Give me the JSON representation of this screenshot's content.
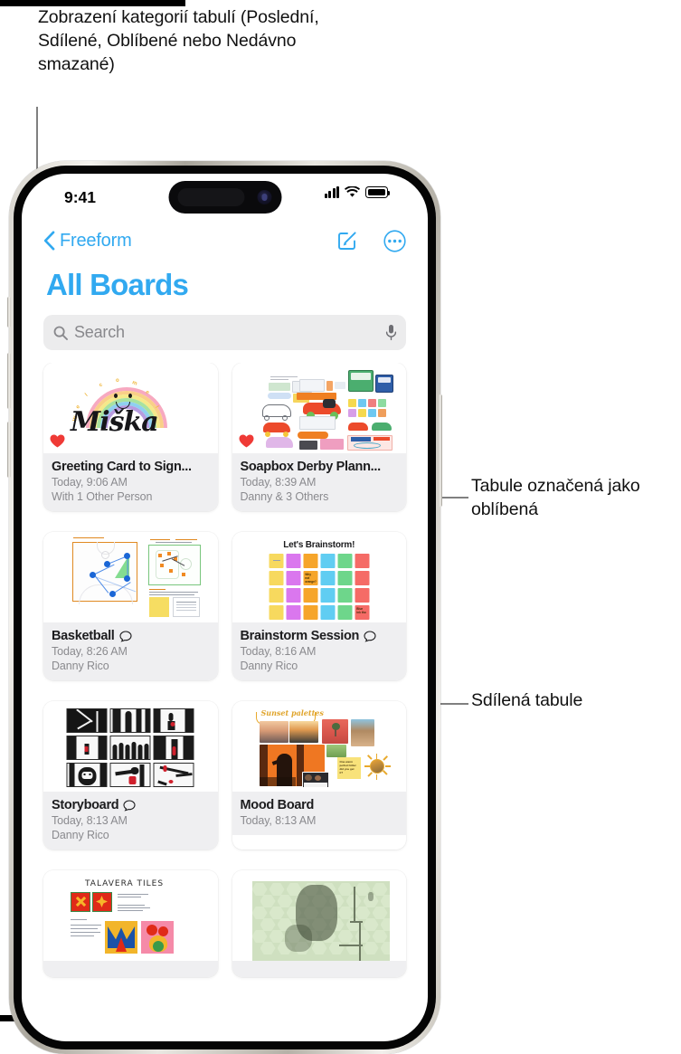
{
  "annotations": {
    "categories": "Zobrazení kategorií tabulí (Poslední, Sdílené, Oblíbené nebo Nedávno smazané)",
    "favorite": "Tabule označená jako oblíbená",
    "shared": "Sdílená tabule"
  },
  "status_bar": {
    "time": "9:41",
    "signal_icon": "cellular-signal-icon",
    "wifi_icon": "wifi-icon",
    "battery_icon": "battery-full-icon"
  },
  "nav": {
    "back_label": "Freeform",
    "back_icon": "chevron-left-icon",
    "compose_icon": "compose-icon",
    "more_icon": "ellipsis-circle-icon"
  },
  "page": {
    "title": "All Boards"
  },
  "search": {
    "placeholder": "Search",
    "search_icon": "search-icon",
    "dictation_icon": "microphone-icon"
  },
  "colors": {
    "accent": "#31a9f0",
    "heart": "#ef3a36",
    "meta_bg": "#efeff1",
    "search_bg": "#ececed",
    "subtitle": "#8a8a8e"
  },
  "boards": [
    {
      "name": "Greeting Card to Sign...",
      "time": "Today, 9:06 AM",
      "people": "With 1 Other Person",
      "favorite": true,
      "shared": false,
      "thumb": "greeting-card",
      "thumb_text": "Miška",
      "thumb_letters": [
        "W",
        "e",
        "l",
        "c",
        "o",
        "m",
        "e"
      ]
    },
    {
      "name": "Soapbox Derby Plann...",
      "time": "Today, 8:39 AM",
      "people": "Danny & 3 Others",
      "favorite": true,
      "shared": false,
      "thumb": "soapbox-derby"
    },
    {
      "name": "Basketball",
      "time": "Today, 8:26 AM",
      "people": "Danny Rico",
      "favorite": false,
      "shared": true,
      "thumb": "basketball"
    },
    {
      "name": "Brainstorm Session",
      "time": "Today, 8:16 AM",
      "people": "Danny Rico",
      "favorite": false,
      "shared": true,
      "thumb": "brainstorm",
      "thumb_text": "Let's Brainstorm!",
      "note_texts": [
        "Why not orange?",
        "Blue ink tho"
      ]
    },
    {
      "name": "Storyboard",
      "time": "Today, 8:13 AM",
      "people": "Danny Rico",
      "favorite": false,
      "shared": true,
      "thumb": "storyboard"
    },
    {
      "name": "Mood Board",
      "time": "Today, 8:13 AM",
      "people": "",
      "favorite": false,
      "shared": false,
      "thumb": "mood-board",
      "thumb_text": "Sunset palettes"
    },
    {
      "name": "",
      "time": "",
      "people": "",
      "favorite": false,
      "shared": false,
      "thumb": "talavera",
      "thumb_text": "TALAVERA TILES"
    },
    {
      "name": "",
      "time": "",
      "people": "",
      "favorite": false,
      "shared": false,
      "thumb": "map"
    }
  ]
}
